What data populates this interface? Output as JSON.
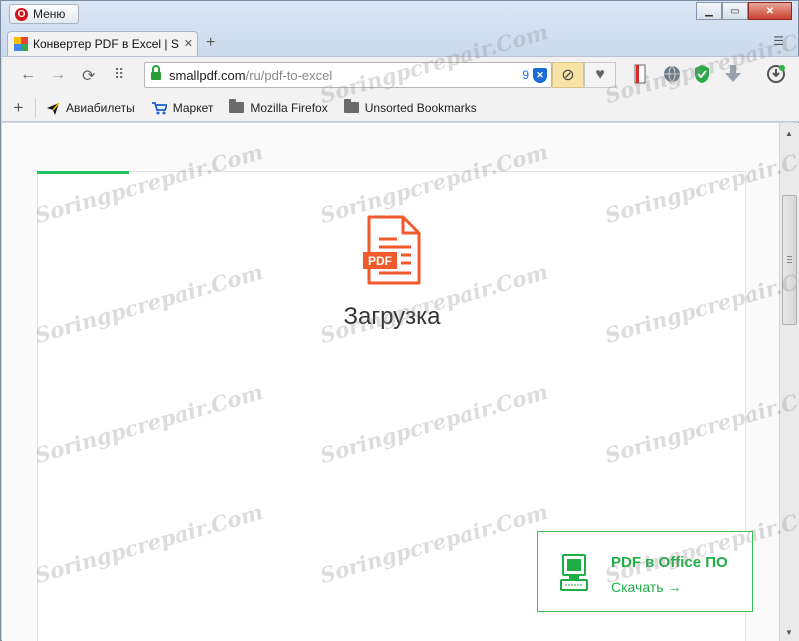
{
  "titlebar": {
    "menu_label": "Меню",
    "menu_logo": "O",
    "controls": {
      "minimize": "▁",
      "maximize": "▭",
      "close": "✕"
    }
  },
  "tab": {
    "title": "Конвертер PDF в Excel | S",
    "close": "✕",
    "new_tab": "+",
    "tabs_menu": "☰"
  },
  "toolbar": {
    "back": "←",
    "forward": "→",
    "reload": "⟳",
    "speed_dial": "⠿",
    "url_host": "smallpdf.com",
    "url_path": "/ru/pdf-to-excel",
    "blocked_count": "9",
    "shield_glyph": "✕",
    "block_glyph": "⊘",
    "heart_glyph": "♥",
    "extensions": [
      "bookmark-icon",
      "globe-icon",
      "vpn-shield-icon",
      "download-icon",
      "update-icon"
    ]
  },
  "bookmarks": {
    "add": "+",
    "items": [
      {
        "label": "Авиабилеты",
        "icon": "airplane-icon"
      },
      {
        "label": "Маркет",
        "icon": "cart-icon"
      },
      {
        "label": "Mozilla Firefox",
        "icon": "folder-icon"
      },
      {
        "label": "Unsorted Bookmarks",
        "icon": "folder-icon"
      }
    ]
  },
  "page": {
    "status_text": "Загрузка",
    "pdf_badge": "PDF",
    "progress_fraction": 0.13,
    "accent_color": "#1ec15b",
    "pdf_icon_color": "#f15a2b",
    "promo": {
      "title": "PDF в Office ПО",
      "link": "Скачать →"
    }
  },
  "watermark": "Soringpcrepair.Com"
}
